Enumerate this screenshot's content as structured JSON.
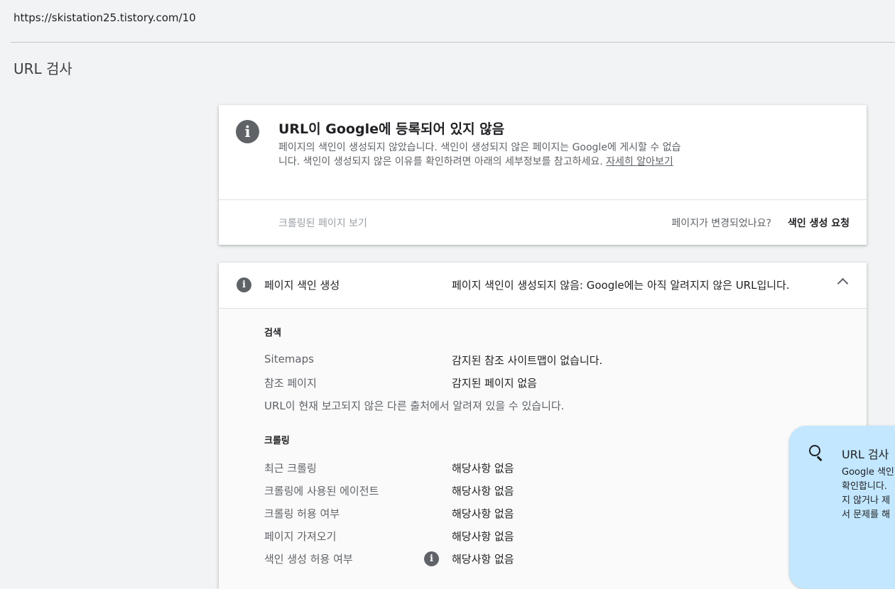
{
  "url": "https://skistation25.tistory.com/10",
  "page_title": "URL 검사",
  "status_card": {
    "title": "URL이 Google에 등록되어 있지 않음",
    "description": "페이지의 색인이 생성되지 않았습니다. 색인이 생성되지 않은 페이지는 Google에 게시할 수 없습니다. 색인이 생성되지 않은 이유를 확인하려면 아래의 세부정보를 참고하세요.",
    "learn_more": "자세히 알아보기",
    "view_crawled": "크롤링된 페이지 보기",
    "changed_question": "페이지가 변경되었나요?",
    "request_indexing": "색인 생성 요청"
  },
  "indexing_card": {
    "header_label": "페이지 색인 생성",
    "header_value": "페이지 색인이 생성되지 않음: Google에는 아직 알려지지 않은 URL입니다.",
    "discovery": {
      "title": "검색",
      "rows": [
        {
          "label": "Sitemaps",
          "value": "감지된 참조 사이트맵이 없습니다."
        },
        {
          "label": "참조 페이지",
          "value": "감지된 페이지 없음"
        }
      ],
      "note": "URL이 현재 보고되지 않은 다른 출처에서 알려져 있을 수 있습니다."
    },
    "crawl": {
      "title": "크롤링",
      "rows": [
        {
          "label": "최근 크롤링",
          "value": "해당사항 없음"
        },
        {
          "label": "크롤링에 사용된 에이전트",
          "value": "해당사항 없음"
        },
        {
          "label": "크롤링 허용 여부",
          "value": "해당사항 없음"
        },
        {
          "label": "페이지 가져오기",
          "value": "해당사항 없음"
        },
        {
          "label": "색인 생성 허용 여부",
          "value": "해당사항 없음"
        }
      ]
    }
  },
  "tip": {
    "title": "URL 검사",
    "lines": [
      "Google 색인",
      "확인합니다. ",
      "지 않거나 제",
      "서 문제를 해"
    ]
  },
  "icons": {
    "info": "info-icon",
    "expand": "chevron-up-icon",
    "search": "search-icon"
  },
  "colors": {
    "tip_bg": "#c2e7ff",
    "background": "#f1f3f4",
    "icon_gray": "#5f6368"
  }
}
